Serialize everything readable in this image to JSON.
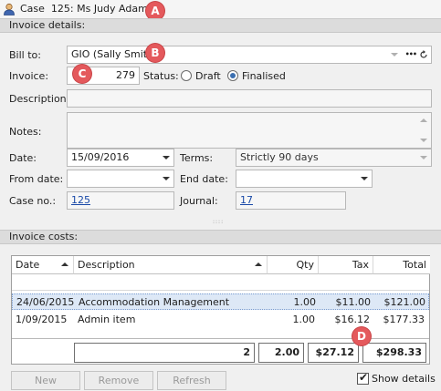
{
  "window": {
    "title_case": "Case",
    "title_detail": "125: Ms Judy Adams"
  },
  "callouts": {
    "a": "A",
    "b": "B",
    "c": "C",
    "d": "D"
  },
  "invoice_details": {
    "header": "Invoice details:",
    "bill_to_label": "Bill to:",
    "bill_to_value": "GIO (Sally Smith)",
    "bill_to_more": "•••",
    "invoice_label": "Invoice:",
    "invoice_number": "279",
    "status_label": "Status:",
    "status_draft": "Draft",
    "status_finalised": "Finalised",
    "status_selected": "Finalised",
    "description_label": "Description:",
    "description_value": "",
    "notes_label": "Notes:",
    "notes_value": "",
    "date_label": "Date:",
    "date_value": "15/09/2016",
    "terms_label": "Terms:",
    "terms_value": "Strictly 90 days",
    "from_date_label": "From date:",
    "from_date_value": "",
    "end_date_label": "End date:",
    "end_date_value": "",
    "case_no_label": "Case no.:",
    "case_no_value": "125",
    "journal_label": "Journal:",
    "journal_value": "17"
  },
  "invoice_costs": {
    "header": "Invoice costs:",
    "columns": {
      "date": "Date",
      "description": "Description",
      "qty": "Qty",
      "tax": "Tax",
      "total": "Total"
    },
    "rows": [
      {
        "date": "24/06/2015",
        "description": "Accommodation Management",
        "qty": "1.00",
        "tax": "$11.00",
        "total": "$121.00"
      },
      {
        "date": "1/09/2015",
        "description": "Admin item",
        "qty": "1.00",
        "tax": "$16.12",
        "total": "$177.33"
      }
    ],
    "totals": {
      "count": "2",
      "qty": "2.00",
      "tax": "$27.12",
      "total": "$298.33"
    }
  },
  "buttons": {
    "new": "New",
    "remove": "Remove",
    "refresh": "Refresh"
  },
  "show_details": {
    "label": "Show details",
    "checked": true
  },
  "icons": {
    "person": "person-icon",
    "refresh": "refresh-icon",
    "dropdown": "chevron-down-icon",
    "sort": "sort-ascending-icon"
  },
  "colors": {
    "callout": "#e4595c",
    "link": "#1a4aa8",
    "selected_row": "#dde8f6",
    "radio_selected": "#3b6fb0"
  }
}
